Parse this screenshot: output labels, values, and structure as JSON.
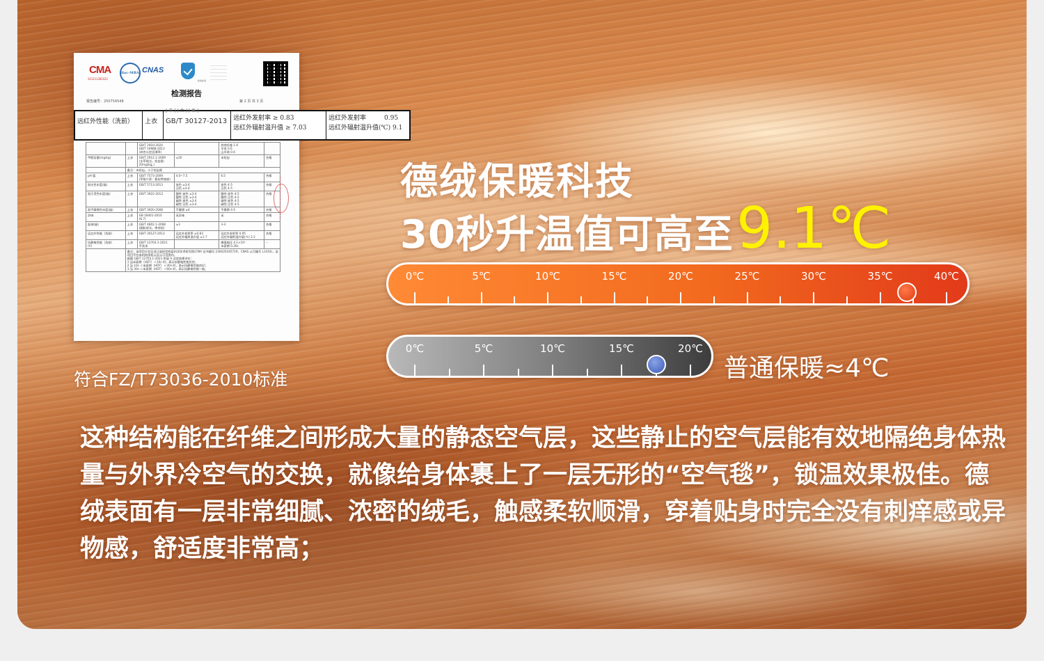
{
  "report": {
    "logos": [
      "CMA",
      "ilac-MRA",
      "CNAS",
      "检验检测"
    ],
    "cma_number": "241111282432",
    "title": "检测报告",
    "report_no": "报告编号：250754548",
    "page": "第 2 页 共 3 页",
    "rows": [
      [
        "",
        "",
        "GB/T 2910-2024\nGB/T 16988-2013\n(综合公定回潮率)",
        "",
        "其他纤维 1.6\n羊毛 0.6\n山羊绒 0.6",
        ""
      ],
      [
        "甲醛含量(mg/kg)",
        "上衣",
        "GB/T 2912.1-2009\n(水萃取法，检出限：\n20mg/kg。)",
        "≤20",
        "未检出",
        "合格"
      ],
      [
        "",
        "",
        "备注：未检出，小于检出限",
        "",
        "",
        ""
      ],
      [
        "pH 值",
        "上衣",
        "GB/T 7573-2009\n(萃取介质：氯化钾溶液)",
        "4.0~7.5",
        "6.5",
        "合格"
      ],
      [
        "耐水色牢度(级)",
        "上衣",
        "GB/T 5713-2013",
        "变色 ≥3-4\n沾色 ≥3-4",
        "变色 4-5\n沾色 4-5",
        "合格"
      ],
      [
        "耐汗渍色牢度(级)",
        "上衣",
        "GB/T 3922-2013",
        "酸性:变色 ≥3-4\n酸性:沾色 ≥3-4\n碱性:变色 ≥3-4\n碱性:沾色 ≥3-4",
        "酸性:变色 4-5\n酸性:沾色 4-5\n碱性:变色 4-5\n碱性:沾色 4-5",
        "合格"
      ],
      [
        "耐干摩擦色牢度(级)",
        "上衣",
        "GB/T 3920-2008",
        "干摩擦 ≥4",
        "干摩擦 4-5",
        "合格"
      ],
      [
        "异味",
        "上衣",
        "GB 18401-2010\n(6.7)",
        "无异味",
        "无",
        "合格"
      ],
      [
        "起球(级)",
        "上衣",
        "GB/T 4802.1-2008\n(圆轨迹法，带毛毡)",
        "≥3",
        "3-3",
        "合格"
      ],
      [
        "远红外性能（洗前）",
        "上衣",
        "GB/T 30127-2013",
        "远红外发射率 ≥0.83\n远红外辐射温升值 ≥1.7",
        "远红外发射率 0.95\n远红外辐射温升值(℃) 2.2",
        "合格"
      ],
      [
        "抗静电性能（洗前）\n(V)",
        "上衣",
        "GB/T 12703.1-2021\n不洗涤",
        "",
        "峰值电压 4.1×10²\n半衰期 0.26s",
        "--"
      ],
      [
        "",
        "",
        "备注：该项目分包至浙江省检验检疫科学技术研究院(CMA 证书编号 230020345729，CNAS 认可编号 L3354)，该项目不在本机构授权认证认可范围内。\n根据 GB/T 12703.1-2021 附录 A 试验结果评价：\n1.当半衰期（HDT）＜10s 时，表示抗静电性能优良；\n2.当 10s ＜半衰期（HDT）＜30s 时，表示抗静电性能良好；\n3.当 30s ＜半衰期（HDT）＜60s 时，表示抗静电性能一般。",
        "",
        "",
        ""
      ]
    ]
  },
  "highlight": {
    "top_fragment": "[ 不 ] [ 合 ] [ 格 ]",
    "item": "远红外性能（洗前）",
    "part": "上衣",
    "standard": "GB/T 30127-2013",
    "req_emissivity": "远红外发射率 ≥ 0.83",
    "req_temp_rise": "远红外辐射温升值 ≥ 7.03",
    "res_emissivity_label": "远红外发射率",
    "res_emissivity_value": "0.95",
    "res_temp_rise": "远红外辐射温升值(℃) 9.1"
  },
  "standard_caption": "符合FZ/T73036-2010标准",
  "headline": {
    "line1": "德绒保暖科技",
    "line2": "30秒升温值可高至",
    "highlight_value": "9.1℃"
  },
  "thermometers": [
    {
      "id": "warm",
      "range": [
        0,
        40
      ],
      "labels": [
        "0℃",
        "5℃",
        "10℃",
        "15℃",
        "20℃",
        "25℃",
        "30℃",
        "35℃",
        "40℃"
      ],
      "value_c": 37,
      "color": "#f26a1e"
    },
    {
      "id": "cool",
      "range": [
        0,
        20
      ],
      "labels": [
        "0℃",
        "5℃",
        "10℃",
        "15℃",
        "20℃"
      ],
      "value_c": 17.5,
      "color": "#7a7a7a"
    }
  ],
  "normal_label": "普通保暖≈4℃",
  "description": "这种结构能在纤维之间形成大量的静态空气层，这些静止的空气层能有效地隔绝身体热量与外界冷空气的交换，就像给身体裹上了一层无形的“空气毯”，锁温效果极佳。德绒表面有一层非常细腻、浓密的绒毛，触感柔软顺滑，穿着贴身时完全没有刺痒感或异物感，舒适度非常高；"
}
